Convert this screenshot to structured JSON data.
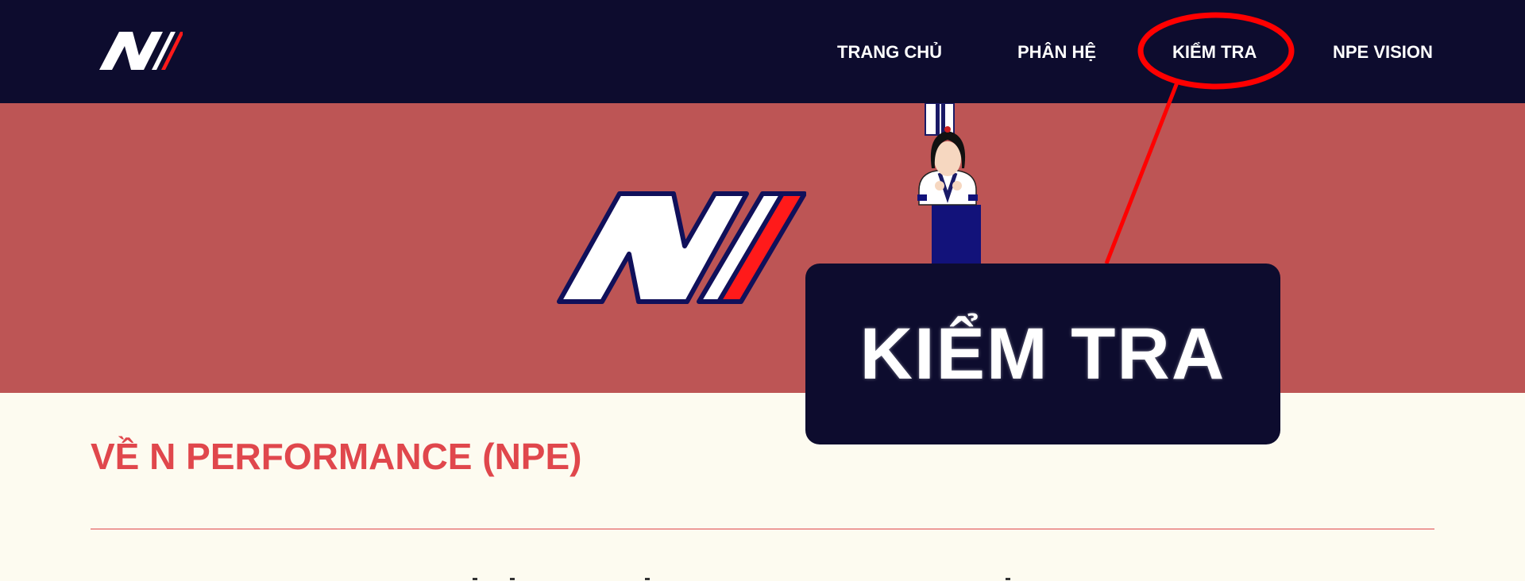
{
  "header": {
    "nav": [
      {
        "label": "TRANG CHỦ"
      },
      {
        "label": "PHÂN HỆ"
      },
      {
        "label": "KIỂM TRA"
      },
      {
        "label": "NPE VISION"
      }
    ]
  },
  "callout": {
    "text": "KIỂM TRA"
  },
  "about": {
    "title": "VỀ N PERFORMANCE (NPE)"
  },
  "colors": {
    "navy": "#0d0c2e",
    "hero_red": "#bd5555",
    "accent_red": "#e0474c",
    "annotation_red": "#ff0000",
    "cream": "#fdfbf0"
  }
}
